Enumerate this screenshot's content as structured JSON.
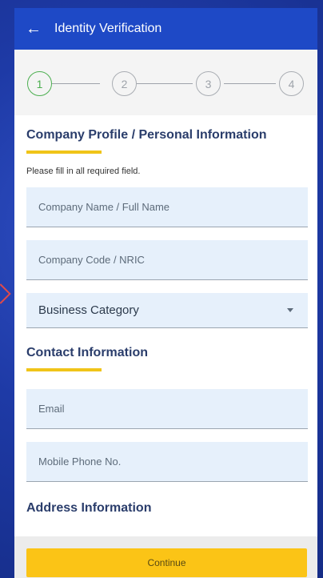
{
  "header": {
    "title": "Identity Verification"
  },
  "steps": [
    "1",
    "2",
    "3",
    "4"
  ],
  "sections": {
    "company_profile": "Company Profile / Personal Information",
    "contact": "Contact Information",
    "address": "Address Information"
  },
  "helper_text": "Please fill in all required field.",
  "fields": {
    "name_placeholder": "Company Name / Full Name",
    "code_placeholder": "Company Code / NRIC",
    "business_category": "Business Category",
    "email_placeholder": "Email",
    "mobile_placeholder": "Mobile Phone No."
  },
  "continue_label": "Continue"
}
